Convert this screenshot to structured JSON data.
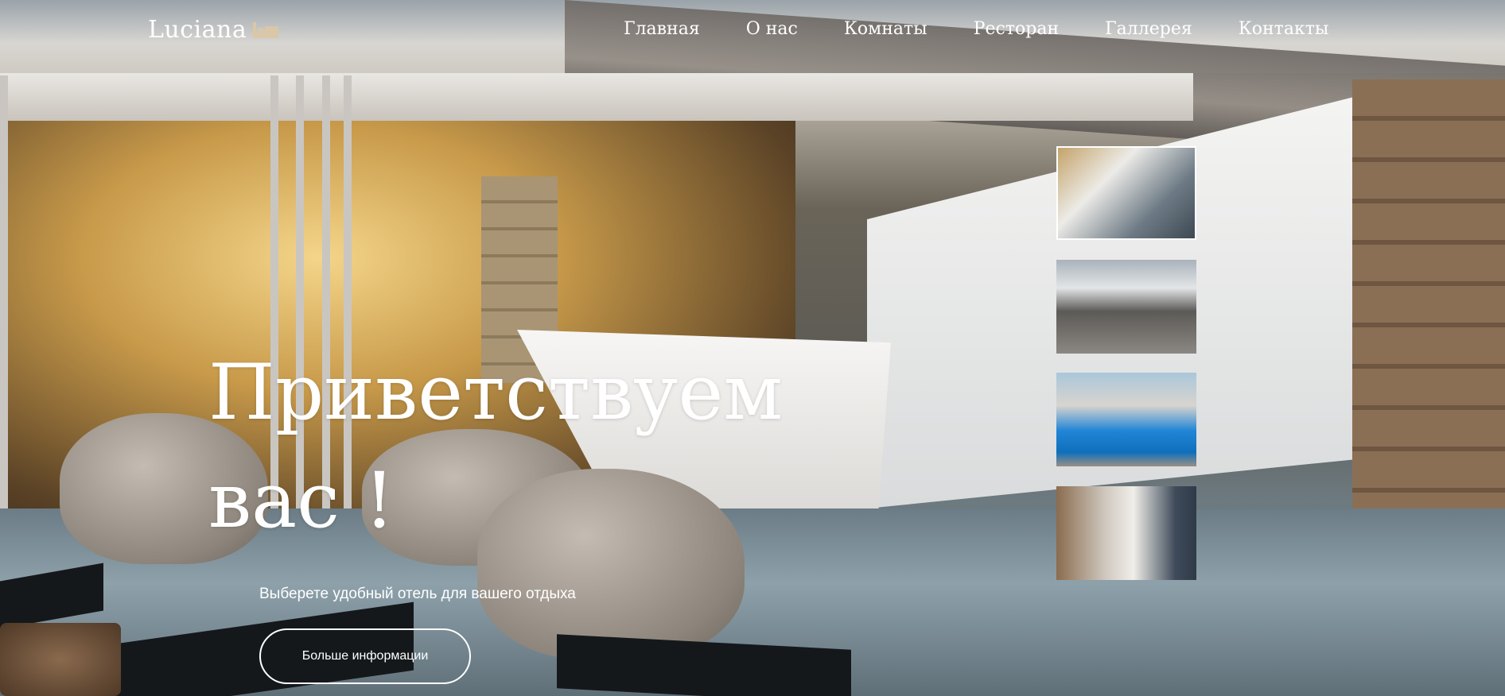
{
  "brand": {
    "name": "Luciana",
    "icon": "bed-icon"
  },
  "nav": {
    "items": [
      "Главная",
      "О нас",
      "Комнаты",
      "Ресторан",
      "Галлерея",
      "Контакты"
    ]
  },
  "hero": {
    "headline_line1": "Приветствуем",
    "headline_line2": "вас !",
    "subtitle": "Выберете удобный отель для вашего отдыха",
    "button_label": "Больше информации"
  },
  "gallery": {
    "thumbnails": [
      {
        "name": "lounge-thumbnail",
        "active": true
      },
      {
        "name": "mountain-lounge-thumbnail",
        "active": false
      },
      {
        "name": "pool-thumbnail",
        "active": false
      },
      {
        "name": "bedroom-thumbnail",
        "active": false
      }
    ]
  }
}
